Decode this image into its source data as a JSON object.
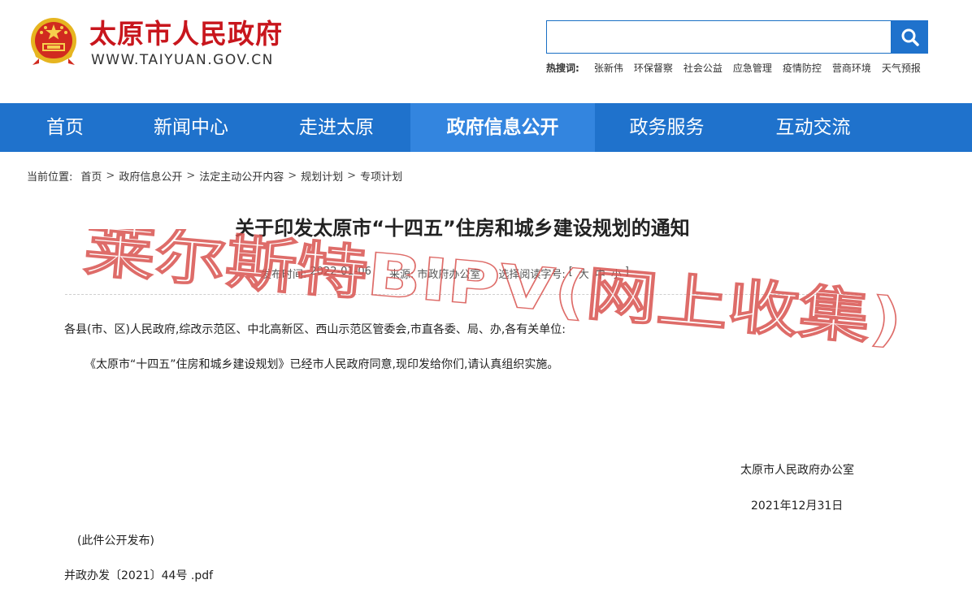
{
  "header": {
    "site_title": "太原市人民政府",
    "site_url": "WWW.TAIYUAN.GOV.CN",
    "emblem_icon": "national-emblem-icon"
  },
  "search": {
    "value": "",
    "placeholder": "",
    "button_icon": "search-icon",
    "hot_label": "热搜词:",
    "hot_words": [
      "张新伟",
      "环保督察",
      "社会公益",
      "应急管理",
      "疫情防控",
      "营商环境",
      "天气预报"
    ]
  },
  "nav": {
    "items": [
      {
        "label": "首页"
      },
      {
        "label": "新闻中心"
      },
      {
        "label": "走进太原"
      },
      {
        "label": "政府信息公开"
      },
      {
        "label": "政务服务"
      },
      {
        "label": "互动交流"
      }
    ],
    "active_index": 3
  },
  "breadcrumb": {
    "prefix": "当前位置:",
    "items": [
      "首页",
      "政府信息公开",
      "法定主动公开内容",
      "规划计划",
      "专项计划"
    ],
    "separator": ">"
  },
  "article": {
    "title": "关于印发太原市“十四五”住房和城乡建设规划的通知",
    "meta": {
      "publish_label": "发布时间:",
      "publish_date": "2022-01-06",
      "source_label": "来源:",
      "source": "市政府办公室",
      "font_label": "选择阅读字号:",
      "font_open": "[",
      "font_options": [
        "大",
        "中",
        "小"
      ],
      "font_close": "]"
    },
    "recipients": "各县(市、区)人民政府,综改示范区、中北高新区、西山示范区管委会,市直各委、局、办,各有关单位:",
    "body": "《太原市“十四五”住房和城乡建设规划》已经市人民政府同意,现印发给你们,请认真组织实施。",
    "signature": "太原市人民政府办公室",
    "date": "2021年12月31日",
    "note": "(此件公开发布)",
    "attachment": "并政办发〔2021〕44号 .pdf"
  },
  "watermark": {
    "text": "莱尔斯特BIPV(网上收集)"
  },
  "colors": {
    "brand_red": "#c8161d",
    "nav_blue": "#1f72cc",
    "nav_active": "#3385df",
    "watermark": "#d9534f"
  }
}
